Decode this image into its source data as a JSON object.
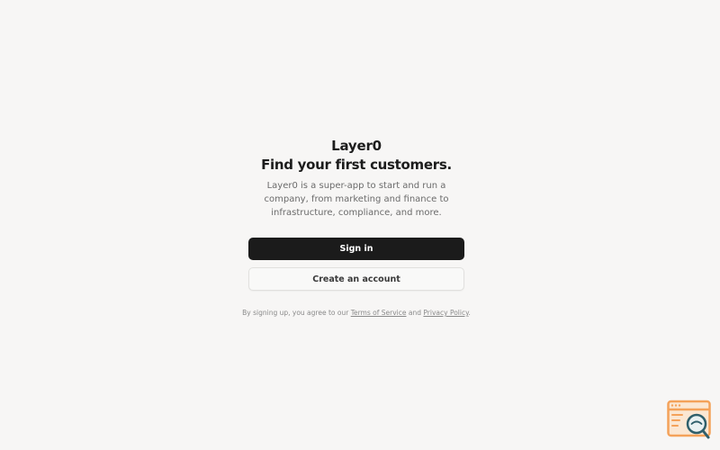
{
  "brand": {
    "name": "Layer0"
  },
  "hero": {
    "headline": "Find your first customers.",
    "description": "Layer0 is a super-app to start and run a company, from marketing and finance to infrastructure, compliance, and more."
  },
  "actions": {
    "sign_in_label": "Sign in",
    "create_account_label": "Create an account"
  },
  "legal": {
    "prefix": "By signing up, you agree to our",
    "terms_label": "Terms of Service",
    "conjunction": "and",
    "privacy_label": "Privacy Policy",
    "suffix": "."
  },
  "widget": {
    "icon": "search-window-icon",
    "colors": {
      "window": "#f4a25a",
      "lens": "#2f5f6b"
    }
  },
  "colors": {
    "background": "#f7f6f5",
    "primary_button": "#1b1b1b",
    "secondary_button_border": "#e1e0de"
  }
}
